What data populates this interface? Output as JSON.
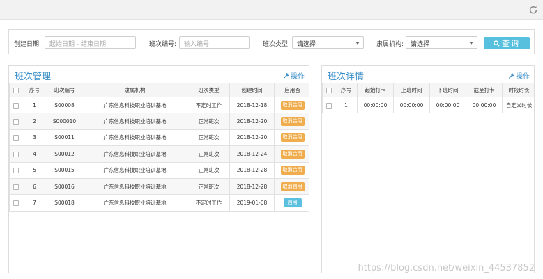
{
  "search": {
    "create_date_label": "创建日期:",
    "create_date_placeholder": "起始日期 - 结束日期",
    "shift_no_label": "班次编号:",
    "shift_no_placeholder": "输入编号",
    "shift_type_label": "班次类型:",
    "shift_type_value": "请选择",
    "org_label": "隶属机构:",
    "org_value": "请选择",
    "query_label": "查询"
  },
  "left_panel": {
    "title": "班次管理",
    "action": "操作",
    "columns": [
      "序号",
      "班次编号",
      "隶属机构",
      "班次类型",
      "创建时间",
      "启用否"
    ],
    "rows": [
      {
        "no": "1",
        "code": "S00008",
        "org": "广东信息科技职业培训基地",
        "type": "不定时工作",
        "date": "2018-12-18",
        "status": "取消启用",
        "status_kind": "cancel"
      },
      {
        "no": "2",
        "code": "S000010",
        "org": "广东信息科技职业培训基地",
        "type": "正常班次",
        "date": "2018-12-20",
        "status": "取消启用",
        "status_kind": "cancel"
      },
      {
        "no": "3",
        "code": "S00011",
        "org": "广东信息科技职业培训基地",
        "type": "正常班次",
        "date": "2018-12-20",
        "status": "取消启用",
        "status_kind": "cancel"
      },
      {
        "no": "4",
        "code": "S00012",
        "org": "广东信息科技职业培训基地",
        "type": "正常班次",
        "date": "2018-12-24",
        "status": "取消启用",
        "status_kind": "cancel"
      },
      {
        "no": "5",
        "code": "S00015",
        "org": "广东信息科技职业培训基地",
        "type": "正常班次",
        "date": "2018-12-28",
        "status": "取消启用",
        "status_kind": "cancel"
      },
      {
        "no": "6",
        "code": "S00016",
        "org": "广东信息科技职业培训基地",
        "type": "正常班次",
        "date": "2018-12-28",
        "status": "取消启用",
        "status_kind": "cancel"
      },
      {
        "no": "7",
        "code": "S00018",
        "org": "广东信息科技职业培训基地",
        "type": "不定时工作",
        "date": "2019-01-08",
        "status": "启用",
        "status_kind": "enable"
      }
    ]
  },
  "right_panel": {
    "title": "班次详情",
    "action": "操作",
    "columns": [
      "序号",
      "起始打卡",
      "上班时间",
      "下班时间",
      "截至打卡",
      "时段时长"
    ],
    "rows": [
      {
        "no": "1",
        "c1": "00:00:00",
        "c2": "00:00:00",
        "c3": "00:00:00",
        "c4": "00:00:00",
        "c5": "自定义时长"
      }
    ]
  },
  "watermark": "https://blog.csdn.net/weixin_44537852",
  "colors": {
    "accent": "#3a8ec9",
    "query_button": "#57c0df",
    "cancel_badge": "#f0ad4e",
    "enable_badge": "#5bc0de"
  },
  "icons": {
    "refresh": "refresh-icon",
    "search": "search-icon",
    "wrench": "wrench-icon"
  }
}
